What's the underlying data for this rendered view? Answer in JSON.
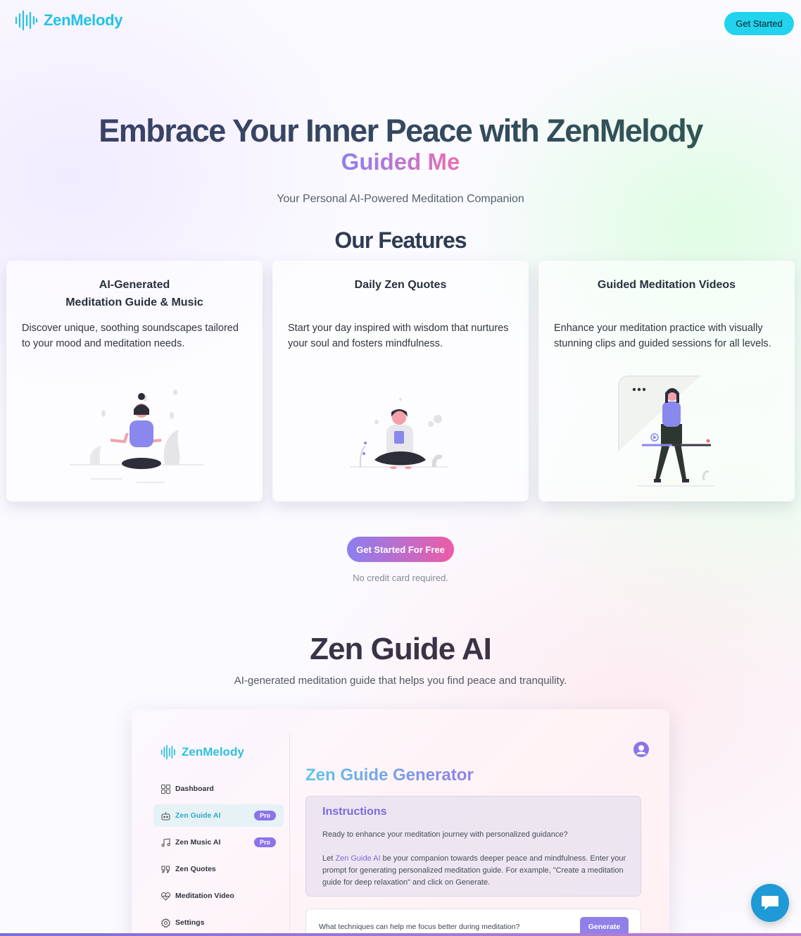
{
  "header": {
    "logo_text": "ZenMelody",
    "cta_label": "Get Started"
  },
  "hero": {
    "title": "Embrace Your Inner Peace with ZenMelody",
    "subtitle": "Guided Me",
    "tagline": "Your Personal AI-Powered Meditation Companion"
  },
  "features": {
    "title": "Our Features",
    "cards": [
      {
        "title_line1": "AI-Generated",
        "title_line2": "Meditation Guide & Music",
        "description": "Discover unique, soothing soundscapes tailored to your mood and meditation needs."
      },
      {
        "title_line1": "Daily Zen Quotes",
        "title_line2": "",
        "description": "Start your day inspired with wisdom that nurtures your soul and fosters mindfulness."
      },
      {
        "title_line1": "Guided Meditation Videos",
        "title_line2": "",
        "description": "Enhance your meditation practice with visually stunning clips and guided sessions for all levels."
      }
    ]
  },
  "cta": {
    "button_label": "Get Started For Free",
    "note": "No credit card required."
  },
  "zen_guide": {
    "title": "Zen Guide AI",
    "subtitle": "AI-generated meditation guide that helps you find peace and tranquility."
  },
  "preview": {
    "logo_text": "ZenMelody",
    "nav": [
      {
        "label": "Dashboard",
        "icon": "grid-icon",
        "badge": ""
      },
      {
        "label": "Zen Guide AI",
        "icon": "robot-icon",
        "badge": "Pro"
      },
      {
        "label": "Zen Music AI",
        "icon": "music-note-icon",
        "badge": "Pro"
      },
      {
        "label": "Zen Quotes",
        "icon": "quote-icon",
        "badge": ""
      },
      {
        "label": "Meditation Video",
        "icon": "heart-pulse-icon",
        "badge": ""
      },
      {
        "label": "Settings",
        "icon": "gear-icon",
        "badge": ""
      }
    ],
    "generator_title": "Zen Guide Generator",
    "instructions_title": "Instructions",
    "instructions_p1": "Ready to enhance your meditation journey with personalized guidance?",
    "instructions_p2_before": "Let ",
    "instructions_p2_link": "Zen Guide AI",
    "instructions_p2_after": " be your companion towards deeper peace and mindfulness. Enter your prompt for generating personalized meditation guide. For example, \"Create a meditation guide for deep relaxation\" and click on Generate.",
    "input_value": "What techniques can help me focus better during meditation?",
    "generate_label": "Generate"
  },
  "colors": {
    "brand_cyan": "#22d3ee",
    "accent_purple": "#8b7ff0",
    "accent_pink": "#ec5ca6",
    "chat_blue": "#1e9ad6"
  }
}
